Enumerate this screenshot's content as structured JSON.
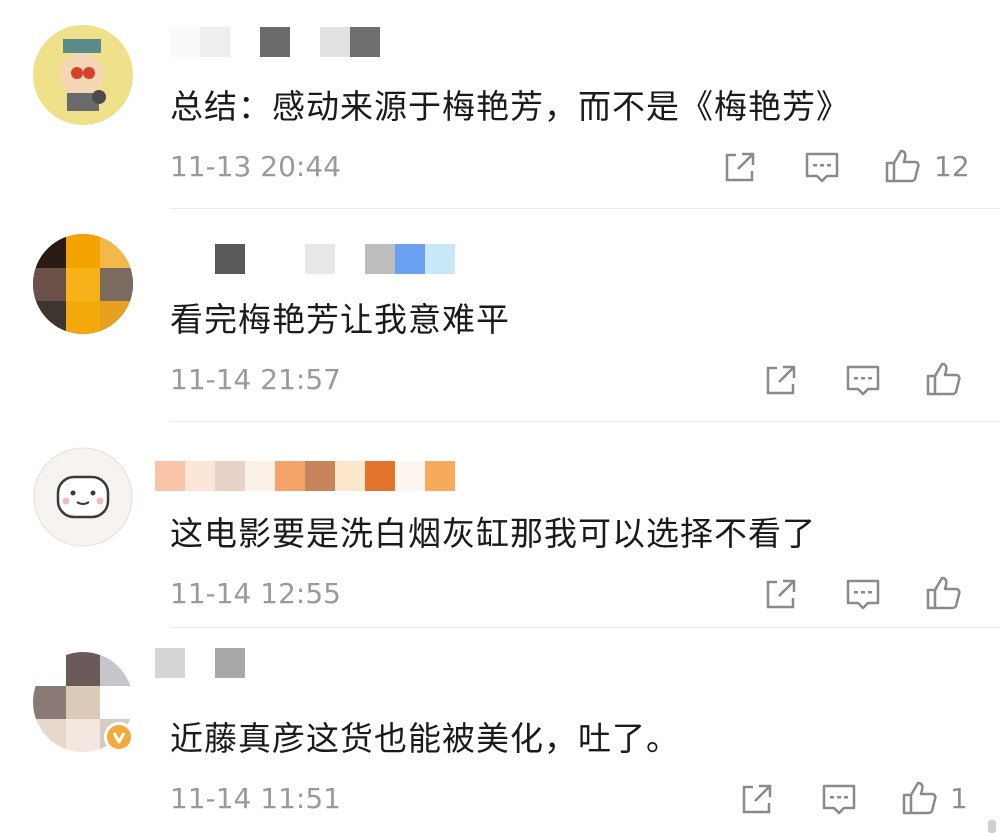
{
  "comments": [
    {
      "text": "总结：感动来源于梅艳芳，而不是《梅艳芳》",
      "time": "11-13 20:44",
      "likes": "12"
    },
    {
      "text": "看完梅艳芳让我意难平",
      "time": "11-14 21:57",
      "likes": ""
    },
    {
      "text": "这电影要是洗白烟灰缸那我可以选择不看了",
      "time": "11-14 12:55",
      "likes": ""
    },
    {
      "text": "近藤真彦这货也能被美化，吐了。",
      "time": "11-14 11:51",
      "likes": "1"
    }
  ],
  "icons": {
    "share": "share-icon",
    "reply": "comment-icon",
    "like": "thumbs-up-icon"
  },
  "colors": {
    "text": "#1a1a1a",
    "meta": "#9a9a9a",
    "icon": "#8a8a8a",
    "verified_badge": "#f4a93a"
  }
}
